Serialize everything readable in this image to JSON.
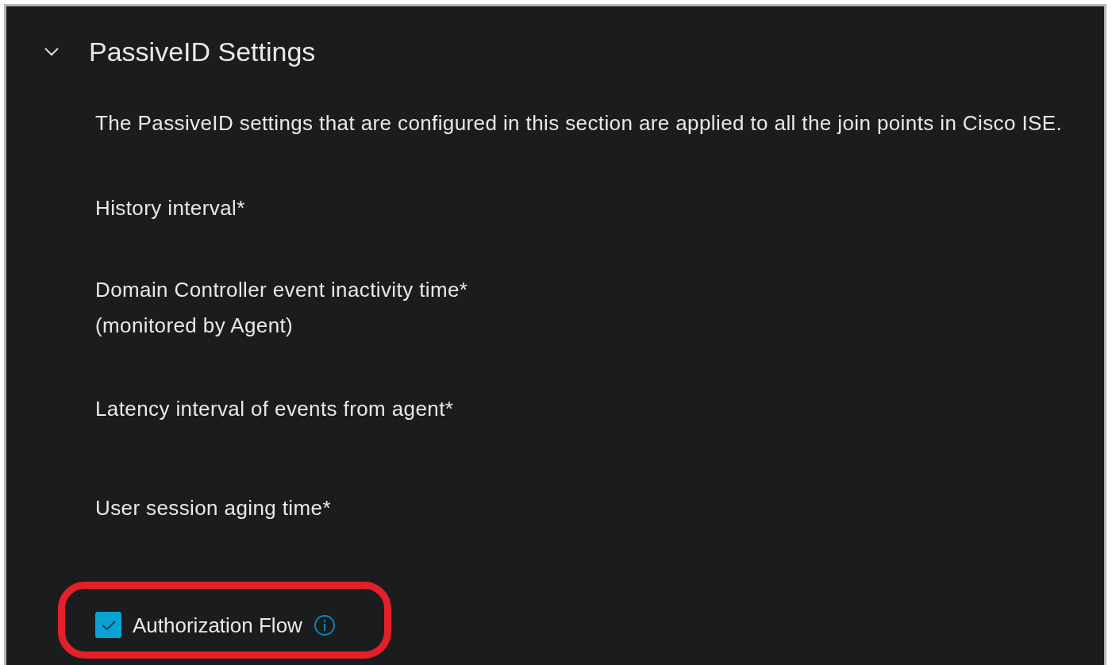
{
  "section": {
    "title": "PassiveID Settings",
    "expanded": true
  },
  "description": "The PassiveID settings that are configured in this section are applied to all the join points in Cisco ISE.",
  "fields": [
    {
      "label": "History interval*"
    },
    {
      "label": "Domain Controller event inactivity time*",
      "note": "(monitored by Agent)"
    },
    {
      "label": "Latency interval of events from agent*"
    },
    {
      "label": "User session aging time*"
    }
  ],
  "checkbox": {
    "label": "Authorization Flow",
    "checked": true
  }
}
